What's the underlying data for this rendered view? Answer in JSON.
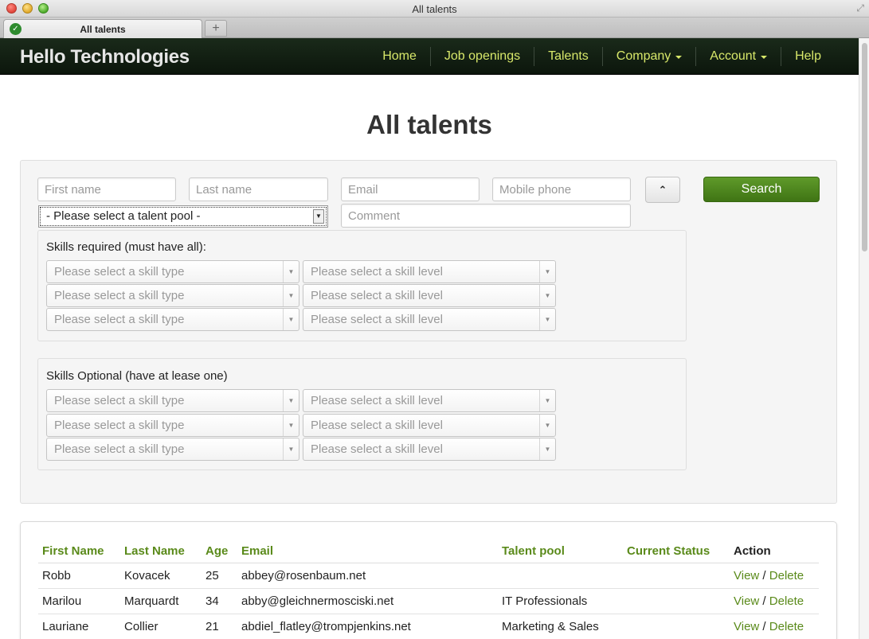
{
  "window": {
    "title": "All talents"
  },
  "tab": {
    "label": "All talents",
    "new_tab": "+"
  },
  "navbar": {
    "brand": "Hello Technologies",
    "items": [
      {
        "label": "Home",
        "dropdown": false
      },
      {
        "label": "Job openings",
        "dropdown": false
      },
      {
        "label": "Talents",
        "dropdown": false
      },
      {
        "label": "Company",
        "dropdown": true
      },
      {
        "label": "Account",
        "dropdown": true
      },
      {
        "label": "Help",
        "dropdown": false
      }
    ],
    "link_color": "#d8e86a"
  },
  "page": {
    "title": "All talents"
  },
  "search": {
    "first_name_placeholder": "First name",
    "last_name_placeholder": "Last name",
    "email_placeholder": "Email",
    "mobile_placeholder": "Mobile phone",
    "comment_placeholder": "Comment",
    "talent_pool_selected": "- Please select a talent pool -",
    "search_label": "Search",
    "search_color": "#4a8320"
  },
  "skills_required": {
    "title": "Skills required (must have all):",
    "rows": [
      {
        "type": "Please select a skill type",
        "level": "Please select a skill level"
      },
      {
        "type": "Please select a skill type",
        "level": "Please select a skill level"
      },
      {
        "type": "Please select a skill type",
        "level": "Please select a skill level"
      }
    ]
  },
  "skills_optional": {
    "title": "Skills Optional (have at lease one)",
    "rows": [
      {
        "type": "Please select a skill type",
        "level": "Please select a skill level"
      },
      {
        "type": "Please select a skill type",
        "level": "Please select a skill level"
      },
      {
        "type": "Please select a skill type",
        "level": "Please select a skill level"
      }
    ]
  },
  "results": {
    "columns": [
      "First Name",
      "Last Name",
      "Age",
      "Email",
      "Talent pool",
      "Current Status",
      "Action"
    ],
    "rows": [
      {
        "first": "Robb",
        "last": "Kovacek",
        "age": "25",
        "email": "abbey@rosenbaum.net",
        "pool": "",
        "status": ""
      },
      {
        "first": "Marilou",
        "last": "Marquardt",
        "age": "34",
        "email": "abby@gleichnermosciski.net",
        "pool": "IT Professionals",
        "status": ""
      },
      {
        "first": "Lauriane",
        "last": "Collier",
        "age": "21",
        "email": "abdiel_flatley@trompjenkins.net",
        "pool": "Marketing & Sales",
        "status": ""
      }
    ],
    "view_label": "View",
    "separator": "/",
    "delete_label": "Delete",
    "link_color": "#5a8a1a"
  }
}
